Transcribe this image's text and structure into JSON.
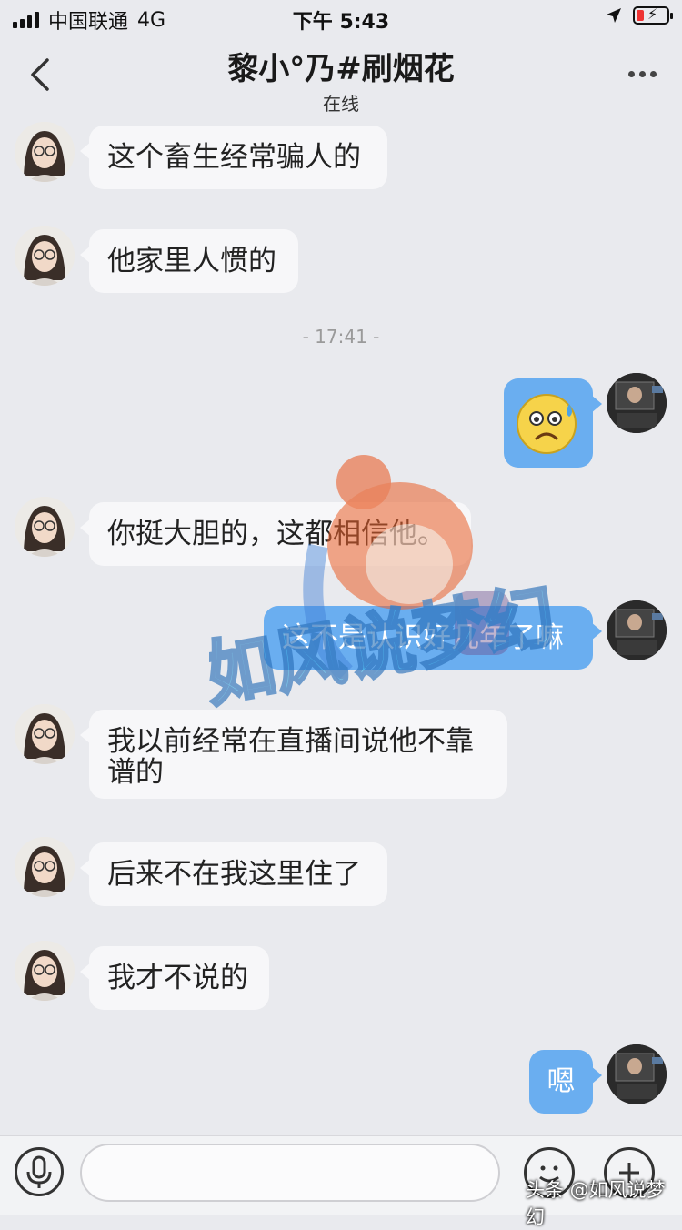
{
  "status_bar": {
    "carrier": "中国联通",
    "network": "4G",
    "time": "下午 5:43"
  },
  "nav": {
    "title": "黎小°乃#刷烟花",
    "subtitle": "在线"
  },
  "messages": [
    {
      "side": "in",
      "text": "这个畜生经常骗人的"
    },
    {
      "side": "in",
      "text": "他家里人惯的"
    },
    {
      "side": "timestamp",
      "text": "- 17:41 -"
    },
    {
      "side": "out",
      "type": "emoji",
      "icon": "anxious-sweat-emoji-icon"
    },
    {
      "side": "in",
      "text": "你挺大胆的，这都相信他。"
    },
    {
      "side": "out",
      "text": "这不是认识好几年了嘛"
    },
    {
      "side": "in",
      "text_line1": "我以前经常在直播间说他不靠",
      "text_line2": "谱的"
    },
    {
      "side": "in",
      "text": "后来不在我这里住了"
    },
    {
      "side": "in",
      "text": "我才不说的"
    },
    {
      "side": "out",
      "text": "嗯"
    }
  ],
  "watermark": {
    "text": "如风说梦幻"
  },
  "credit": "头条 @如风说梦幻",
  "colors": {
    "background": "#e9eaee",
    "incoming_bubble": "#f7f7f9",
    "outgoing_bubble": "#6aaef0"
  }
}
